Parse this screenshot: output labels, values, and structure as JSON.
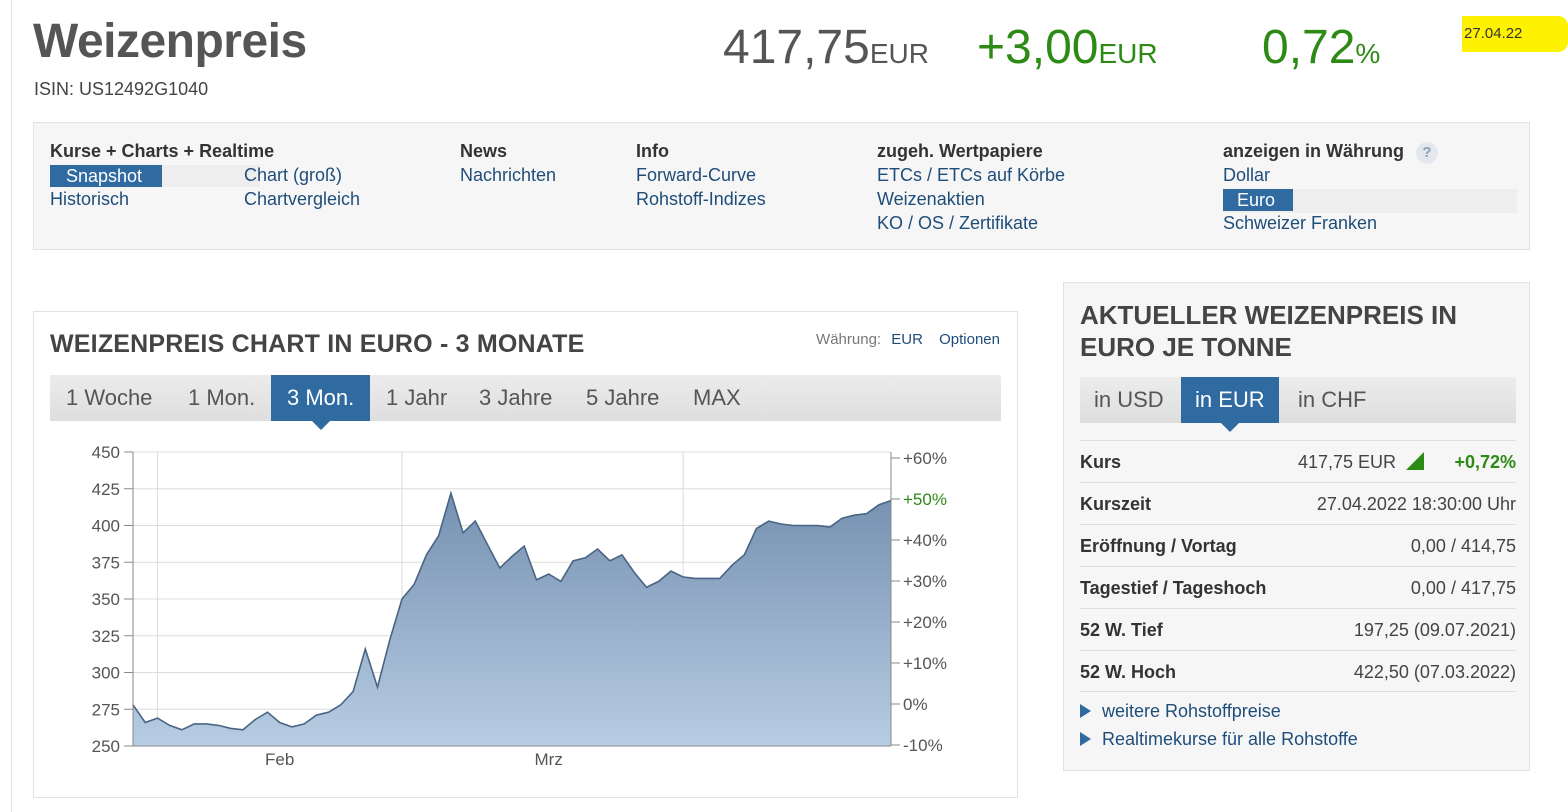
{
  "header": {
    "title": "Weizenpreis",
    "isin": "ISIN: US12492G1040",
    "price": "417,75",
    "price_unit": "EUR",
    "change": "+3,00",
    "change_unit": "EUR",
    "change_pct": "0,72",
    "change_pct_unit": "%",
    "date_highlight": "27.04.22"
  },
  "nav": {
    "col1_head": "Kurse + Charts + Realtime",
    "col1_items": [
      "Snapshot",
      "Chart (groß)",
      "Historisch",
      "Chartvergleich"
    ],
    "col2_head": "News",
    "col2_items": [
      "Nachrichten"
    ],
    "col3_head": "Info",
    "col3_items": [
      "Forward-Curve",
      "Rohstoff-Indizes"
    ],
    "col4_head": "zugeh. Wertpapiere",
    "col4_items": [
      "ETCs / ETCs auf Körbe",
      "Weizenaktien",
      "KO / OS / Zertifikate"
    ],
    "col5_head": "anzeigen in Währung",
    "col5_help": "?",
    "col5_items": [
      "Dollar",
      "Euro",
      "Schweizer Franken"
    ]
  },
  "chart_panel": {
    "title": "WEIZENPREIS CHART IN EURO - 3 MONATE",
    "currency_label": "Währung:",
    "currency_value": "EUR",
    "options_label": "Optionen",
    "tabs": [
      "1 Woche",
      "1 Mon.",
      "3 Mon.",
      "1 Jahr",
      "3 Jahre",
      "5 Jahre",
      "MAX"
    ],
    "active_tab": "3 Mon."
  },
  "chart_data": {
    "type": "area",
    "y_ticks": [
      250,
      275,
      300,
      325,
      350,
      375,
      400,
      425,
      450
    ],
    "ylim": [
      250,
      450
    ],
    "y2_ticks": [
      "-10%",
      "0%",
      "+10%",
      "+20%",
      "+30%",
      "+40%",
      "+50%",
      "+60%"
    ],
    "x_tick_labels": [
      "Feb",
      "Mrz"
    ],
    "fill_color": "#8fa7c2",
    "line_color": "#4a6483",
    "values": [
      278,
      266,
      269,
      264,
      261,
      265,
      265,
      264,
      262,
      261,
      268,
      273,
      266,
      263,
      265,
      271,
      273,
      278,
      287,
      316,
      290,
      322,
      350,
      360,
      380,
      393,
      422,
      395,
      403,
      387,
      371,
      379,
      386,
      363,
      367,
      362,
      376,
      378,
      384,
      376,
      380,
      368,
      358,
      362,
      369,
      365,
      364,
      364,
      364,
      373,
      380,
      398,
      403,
      401,
      400,
      400,
      400,
      399,
      405,
      407,
      408,
      414,
      417
    ]
  },
  "right_panel": {
    "title": "AKTUELLER WEIZENPREIS IN EURO JE TONNE",
    "tabs": [
      "in USD",
      "in EUR",
      "in CHF"
    ],
    "active_tab": "in EUR",
    "rows": [
      {
        "label": "Kurs",
        "value": "417,75 EUR",
        "pct": "+0,72%"
      },
      {
        "label": "Kurszeit",
        "value": "27.04.2022 18:30:00 Uhr"
      },
      {
        "label": "Eröffnung / Vortag",
        "value": "0,00 / 414,75"
      },
      {
        "label": "Tagestief / Tageshoch",
        "value": "0,00 / 417,75"
      },
      {
        "label": "52 W. Tief",
        "value": "197,25 (09.07.2021)"
      },
      {
        "label": "52 W. Hoch",
        "value": "422,50 (07.03.2022)"
      }
    ],
    "links": [
      "weitere Rohstoffpreise",
      "Realtimekurse für alle Rohstoffe"
    ]
  }
}
